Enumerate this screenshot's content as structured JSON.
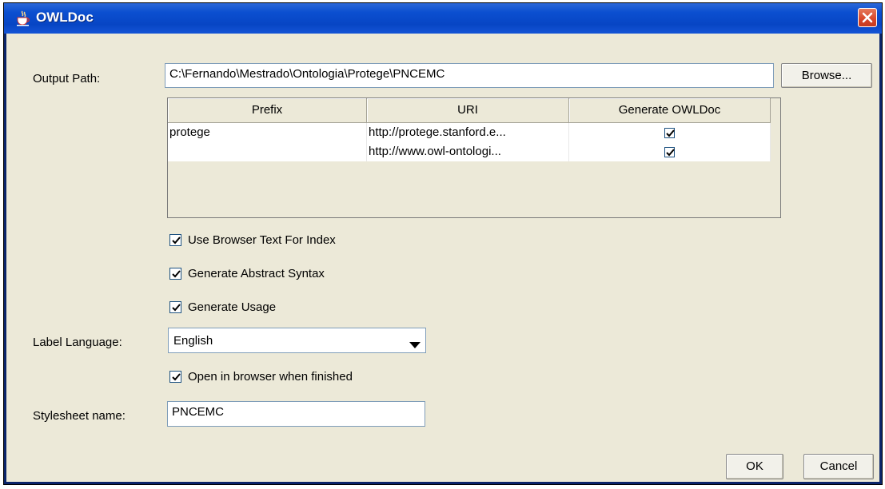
{
  "window": {
    "title": "OWLDoc"
  },
  "output_path": {
    "label": "Output Path:",
    "value": "C:\\Fernando\\Mestrado\\Ontologia\\Protege\\PNCEMC",
    "browse_label": "Browse..."
  },
  "table": {
    "columns": [
      "Prefix",
      "URI",
      "Generate OWLDoc"
    ],
    "rows": [
      {
        "prefix": "protege",
        "uri": "http://protege.stanford.e...",
        "generate": true
      },
      {
        "prefix": "",
        "uri": "http://www.owl-ontologi...",
        "generate": true
      }
    ]
  },
  "options": {
    "use_browser_text": {
      "label": "Use Browser Text For Index",
      "checked": true
    },
    "abstract_syntax": {
      "label": "Generate Abstract Syntax",
      "checked": true
    },
    "usage": {
      "label": "Generate Usage",
      "checked": true
    },
    "open_browser": {
      "label": "Open in browser when finished",
      "checked": true
    }
  },
  "label_language": {
    "label": "Label Language:",
    "value": "English"
  },
  "stylesheet": {
    "label": "Stylesheet name:",
    "value": "PNCEMC"
  },
  "buttons": {
    "ok": "OK",
    "cancel": "Cancel"
  },
  "colors": {
    "titlebar": "#0745c4",
    "dialog_bg": "#ece9d8",
    "close": "#d8462a"
  },
  "icons": {
    "title": "java-cup-icon",
    "close": "close-icon",
    "dropdown": "chevron-down-icon",
    "check": "checkmark-icon"
  }
}
